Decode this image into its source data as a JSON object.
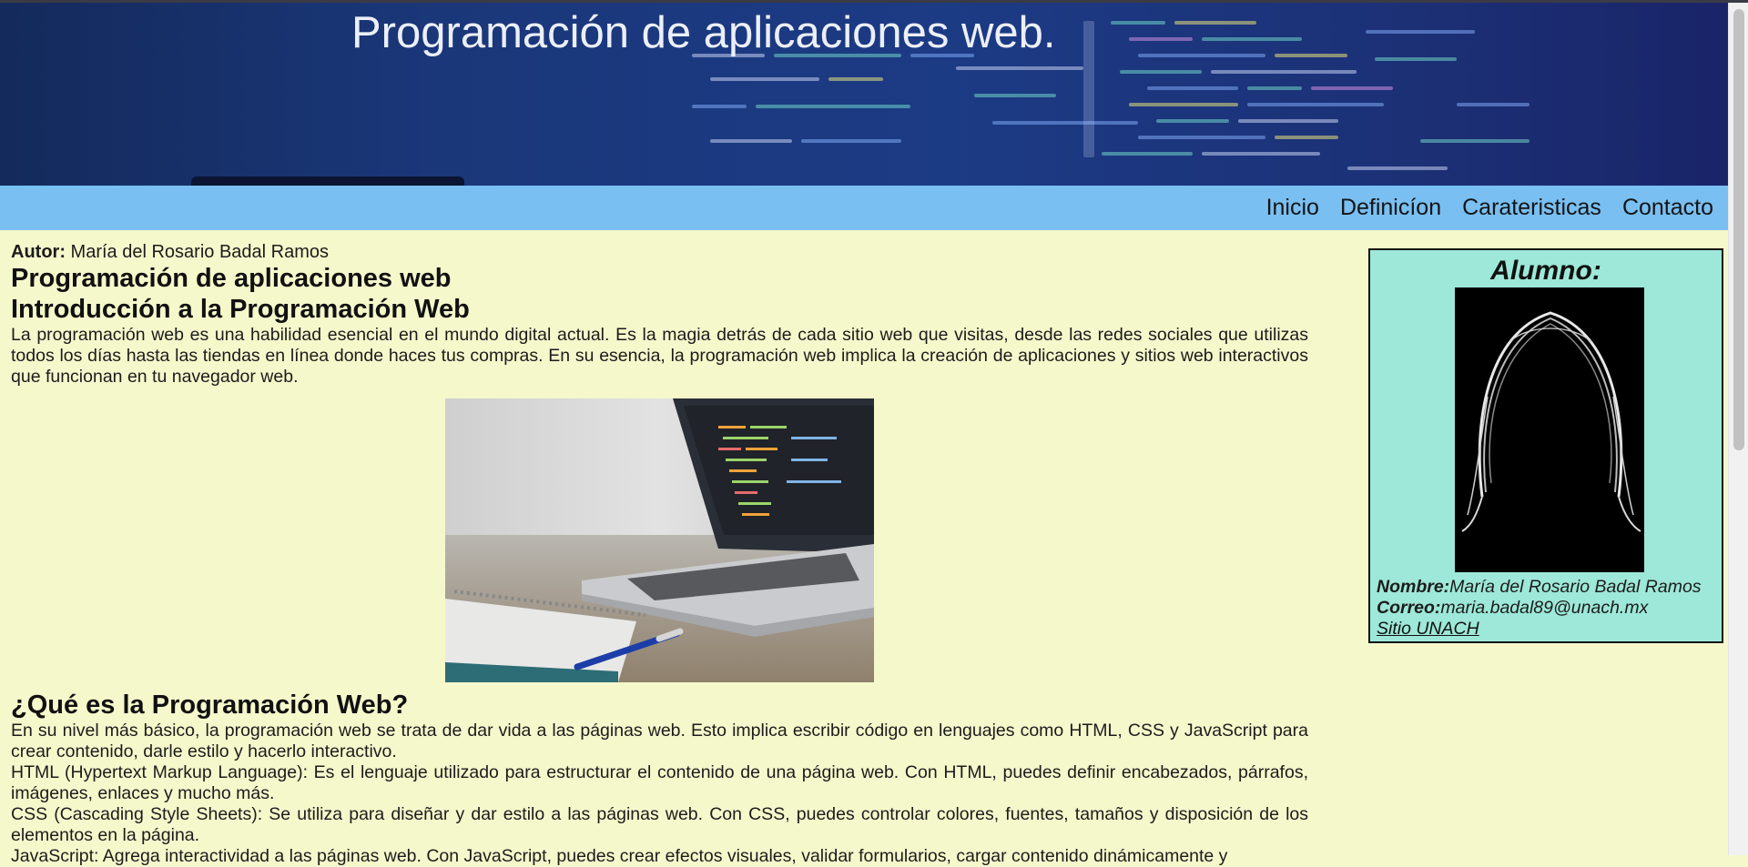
{
  "header": {
    "title": "Programación de aplicaciones web."
  },
  "nav": {
    "items": [
      "Inicio",
      "Definicíon",
      "Carateristicas",
      "Contacto"
    ]
  },
  "main": {
    "author_label": "Autor:",
    "author_name": " María del Rosario Badal Ramos",
    "heading1": "Programación de aplicaciones web",
    "heading2": "Introducción a la Programación Web",
    "intro": "La programación web es una habilidad esencial en el mundo digital actual. Es la magia detrás de cada sitio web que visitas, desde las redes sociales que utilizas todos los días hasta las tiendas en línea donde haces tus compras. En su esencia, la programación web implica la creación de aplicaciones y sitios web interactivos que funcionan en tu navegador web.",
    "heading3": "¿Qué es la Programación Web?",
    "p1": "En su nivel más básico, la programación web se trata de dar vida a las páginas web. Esto implica escribir código en lenguajes como HTML, CSS y JavaScript para crear contenido, darle estilo y hacerlo interactivo.",
    "p2": "HTML (Hypertext Markup Language): Es el lenguaje utilizado para estructurar el contenido de una página web. Con HTML, puedes definir encabezados, párrafos, imágenes, enlaces y mucho más.",
    "p3": "CSS (Cascading Style Sheets): Se utiliza para diseñar y dar estilo a las páginas web. Con CSS, puedes controlar colores, fuentes, tamaños y disposición de los elementos en la página.",
    "p4": "JavaScript: Agrega interactividad a las páginas web. Con JavaScript, puedes crear efectos visuales, validar formularios, cargar contenido dinámicamente y"
  },
  "sidebar": {
    "title": "Alumno:",
    "name_label": "Nombre:",
    "name_value": "María del Rosario Badal Ramos",
    "email_label": "Correo:",
    "email_value": "maria.badal89@unach.mx",
    "link_label": "Sitio UNACH"
  },
  "colors": {
    "page_bg": "#f5f8cb",
    "nav_bg": "#79bff2",
    "sidebar_bg": "#9de8d8",
    "banner_bg": "#1c3b85"
  }
}
